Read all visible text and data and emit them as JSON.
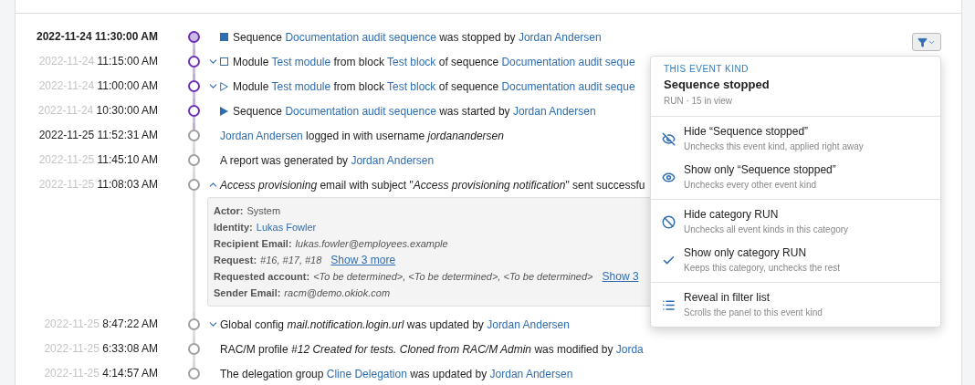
{
  "events": [
    {
      "date": "2022-11-24",
      "time": "11:30:00 AM",
      "selected": true,
      "date_muted": false,
      "color": "#6b2fb3",
      "kind": "stop",
      "segments": [
        {
          "kind": "plain",
          "text": "Sequence"
        },
        {
          "kind": "link",
          "text": "Documentation audit sequence"
        },
        {
          "kind": "plain",
          "text": "was stopped by"
        },
        {
          "kind": "link",
          "text": "Jordan Andersen"
        }
      ]
    },
    {
      "date": "2022-11-24",
      "time": "11:15:00 AM",
      "selected": false,
      "date_muted": true,
      "color": "#6b2fb3",
      "expanded": false,
      "kind": "square-outline",
      "segments": [
        {
          "kind": "plain",
          "text": "Module"
        },
        {
          "kind": "link",
          "text": "Test module"
        },
        {
          "kind": "plain",
          "text": "from block"
        },
        {
          "kind": "link",
          "text": "Test block"
        },
        {
          "kind": "plain",
          "text": "of sequence"
        },
        {
          "kind": "link",
          "text": "Documentation audit seque"
        }
      ]
    },
    {
      "date": "2022-11-24",
      "time": "11:00:00 AM",
      "selected": false,
      "date_muted": true,
      "color": "#6b2fb3",
      "expanded": false,
      "kind": "play-outline",
      "segments": [
        {
          "kind": "plain",
          "text": "Module"
        },
        {
          "kind": "link",
          "text": "Test module"
        },
        {
          "kind": "plain",
          "text": "from block"
        },
        {
          "kind": "link",
          "text": "Test block"
        },
        {
          "kind": "plain",
          "text": "of sequence"
        },
        {
          "kind": "link",
          "text": "Documentation audit seque"
        }
      ]
    },
    {
      "date": "2022-11-24",
      "time": "10:30:00 AM",
      "selected": false,
      "date_muted": true,
      "color": "#6b2fb3",
      "kind": "play",
      "segments": [
        {
          "kind": "plain",
          "text": "Sequence"
        },
        {
          "kind": "link",
          "text": "Documentation audit sequence"
        },
        {
          "kind": "plain",
          "text": "was started by"
        },
        {
          "kind": "link",
          "text": "Jordan Andersen"
        }
      ]
    },
    {
      "date": "2022-11-25",
      "time": "11:52:31 AM",
      "selected": false,
      "date_muted": false,
      "color": "#9e9e9e",
      "segments": [
        {
          "kind": "link",
          "text": "Jordan Andersen"
        },
        {
          "kind": "plain",
          "text": "logged in with username"
        },
        {
          "kind": "italic",
          "text": "jordanandersen"
        }
      ]
    },
    {
      "date": "2022-11-25",
      "time": "11:45:10 AM",
      "selected": false,
      "date_muted": true,
      "color": "#9e9e9e",
      "segments": [
        {
          "kind": "plain",
          "text": "A report was generated by"
        },
        {
          "kind": "link",
          "text": "Jordan Andersen"
        }
      ]
    },
    {
      "date": "2022-11-25",
      "time": "11:08:03 AM",
      "selected": false,
      "date_muted": true,
      "color": "#9e9e9e",
      "expanded": true,
      "segments": [
        {
          "kind": "italic",
          "text": "Access provisioning"
        },
        {
          "kind": "plain",
          "text": "email with subject \"*Access provisioning notification*\" sent successfu"
        }
      ],
      "details": [
        {
          "label": "Actor:",
          "value": "System",
          "kind": "plain"
        },
        {
          "label": "Identity:",
          "value": "Lukas Fowler",
          "kind": "link"
        },
        {
          "label": "Recipient Email:",
          "value": "lukas.fowler@employees.example",
          "kind": "italic"
        },
        {
          "label": "Request:",
          "value": "#16, #17, #18",
          "kind": "italic",
          "more": "Show 3 more"
        },
        {
          "label": "Requested account:",
          "value": "<To be determined>, <To be determined>, <To be determined>",
          "kind": "italic",
          "more": "Show 3"
        },
        {
          "label": "Sender Email:",
          "value": "racm@demo.okiok.com",
          "kind": "italic"
        }
      ]
    },
    {
      "date": "2022-11-25",
      "time": "8:47:22 AM",
      "selected": false,
      "date_muted": true,
      "color": "#9e9e9e",
      "expanded": false,
      "segments": [
        {
          "kind": "plain",
          "text": "Global config"
        },
        {
          "kind": "italic",
          "text": "mail.notification.login.url"
        },
        {
          "kind": "plain",
          "text": "was updated by"
        },
        {
          "kind": "link",
          "text": "Jordan Andersen"
        }
      ]
    },
    {
      "date": "2022-11-25",
      "time": "6:33:08 AM",
      "selected": false,
      "date_muted": true,
      "color": "#9e9e9e",
      "segments": [
        {
          "kind": "plain",
          "text": "RAC/M profile"
        },
        {
          "kind": "italic",
          "text": "#12 Created for tests. Cloned from RAC/M Admin"
        },
        {
          "kind": "plain",
          "text": "was modified by"
        },
        {
          "kind": "link",
          "text": "Jorda"
        }
      ]
    },
    {
      "date": "2022-11-25",
      "time": "4:14:57 AM",
      "selected": false,
      "date_muted": true,
      "color": "#9e9e9e",
      "segments": [
        {
          "kind": "plain",
          "text": "The delegation group"
        },
        {
          "kind": "link",
          "text": "Cline Delegation"
        },
        {
          "kind": "plain",
          "text": "was updated by"
        },
        {
          "kind": "link",
          "text": "Jordan Andersen"
        }
      ]
    }
  ],
  "popup": {
    "eyebrow": "THIS EVENT KIND",
    "title": "Sequence stopped",
    "subtitle": "RUN · 15 in view",
    "groups": [
      [
        {
          "kind": "hide",
          "title": "Hide “Sequence stopped”",
          "hint": "Unchecks this event kind, applied right away"
        },
        {
          "kind": "show-only",
          "title": "Show only “Sequence stopped”",
          "hint": "Unchecks every other event kind"
        }
      ],
      [
        {
          "kind": "hide-category",
          "title": "Hide category RUN",
          "hint": "Unchecks all event kinds in this category"
        },
        {
          "kind": "show-category",
          "title": "Show only category RUN",
          "hint": "Keeps this category, unchecks the rest"
        }
      ],
      [
        {
          "kind": "reveal",
          "title": "Reveal in filter list",
          "hint": "Scrolls the panel to this event kind"
        }
      ]
    ]
  }
}
